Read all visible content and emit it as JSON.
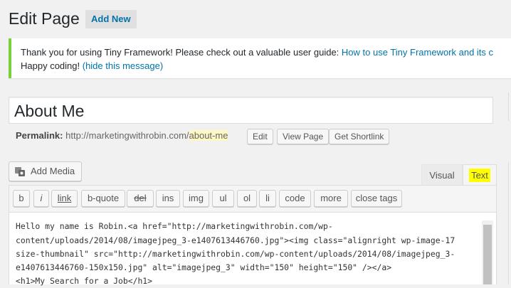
{
  "header": {
    "title": "Edit Page",
    "add_new": "Add New"
  },
  "notice": {
    "text": "Thank you for using Tiny Framework! Please check out a valuable user guide: ",
    "guide_link": "How to use Tiny Framework and its c",
    "line2": "Happy coding! ",
    "hide_link": "(hide this message)",
    "accent": "#7ad03a"
  },
  "post_title": "About Me",
  "permalink": {
    "label": "Permalink:",
    "base": "http://marketingwithrobin.com/",
    "slug": "about-me",
    "edit": "Edit",
    "view": "View Page",
    "shortlink": "Get Shortlink"
  },
  "media": {
    "add_media": "Add Media",
    "icon": "media-icon"
  },
  "tabs": {
    "visual": "Visual",
    "text": "Text"
  },
  "quicktags": [
    "b",
    "i",
    "link",
    "b-quote",
    "del",
    "ins",
    "img",
    "ul",
    "ol",
    "li",
    "code",
    "more",
    "close tags"
  ],
  "content_lines": [
    "Hello my name is Robin.<a href=\"http://marketingwithrobin.com/wp-",
    "content/uploads/2014/08/imagejpeg_3-e1407613446760.jpg\"><img class=\"alignright wp-image-17",
    "size-thumbnail\" src=\"http://marketingwithrobin.com/wp-content/uploads/2014/08/imagejpeg_3-",
    "e1407613446760-150x150.jpg\" alt=\"imagejpeg_3\" width=\"150\" height=\"150\" /></a>",
    "<h1>My Search for a Job</h1>"
  ]
}
